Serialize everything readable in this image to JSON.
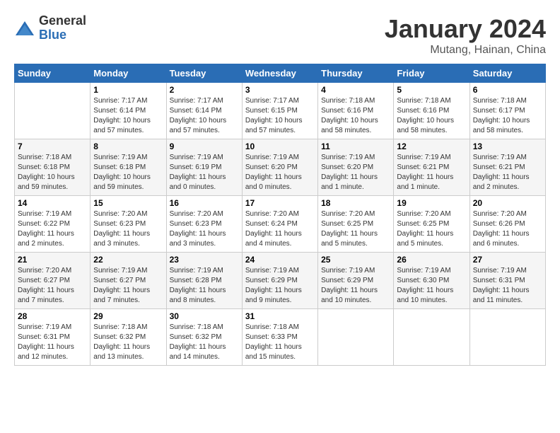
{
  "logo": {
    "general": "General",
    "blue": "Blue"
  },
  "title": "January 2024",
  "subtitle": "Mutang, Hainan, China",
  "days_of_week": [
    "Sunday",
    "Monday",
    "Tuesday",
    "Wednesday",
    "Thursday",
    "Friday",
    "Saturday"
  ],
  "weeks": [
    [
      {
        "day": "",
        "info": ""
      },
      {
        "day": "1",
        "info": "Sunrise: 7:17 AM\nSunset: 6:14 PM\nDaylight: 10 hours\nand 57 minutes."
      },
      {
        "day": "2",
        "info": "Sunrise: 7:17 AM\nSunset: 6:14 PM\nDaylight: 10 hours\nand 57 minutes."
      },
      {
        "day": "3",
        "info": "Sunrise: 7:17 AM\nSunset: 6:15 PM\nDaylight: 10 hours\nand 57 minutes."
      },
      {
        "day": "4",
        "info": "Sunrise: 7:18 AM\nSunset: 6:16 PM\nDaylight: 10 hours\nand 58 minutes."
      },
      {
        "day": "5",
        "info": "Sunrise: 7:18 AM\nSunset: 6:16 PM\nDaylight: 10 hours\nand 58 minutes."
      },
      {
        "day": "6",
        "info": "Sunrise: 7:18 AM\nSunset: 6:17 PM\nDaylight: 10 hours\nand 58 minutes."
      }
    ],
    [
      {
        "day": "7",
        "info": "Sunrise: 7:18 AM\nSunset: 6:18 PM\nDaylight: 10 hours\nand 59 minutes."
      },
      {
        "day": "8",
        "info": "Sunrise: 7:19 AM\nSunset: 6:18 PM\nDaylight: 10 hours\nand 59 minutes."
      },
      {
        "day": "9",
        "info": "Sunrise: 7:19 AM\nSunset: 6:19 PM\nDaylight: 11 hours\nand 0 minutes."
      },
      {
        "day": "10",
        "info": "Sunrise: 7:19 AM\nSunset: 6:20 PM\nDaylight: 11 hours\nand 0 minutes."
      },
      {
        "day": "11",
        "info": "Sunrise: 7:19 AM\nSunset: 6:20 PM\nDaylight: 11 hours\nand 1 minute."
      },
      {
        "day": "12",
        "info": "Sunrise: 7:19 AM\nSunset: 6:21 PM\nDaylight: 11 hours\nand 1 minute."
      },
      {
        "day": "13",
        "info": "Sunrise: 7:19 AM\nSunset: 6:21 PM\nDaylight: 11 hours\nand 2 minutes."
      }
    ],
    [
      {
        "day": "14",
        "info": "Sunrise: 7:19 AM\nSunset: 6:22 PM\nDaylight: 11 hours\nand 2 minutes."
      },
      {
        "day": "15",
        "info": "Sunrise: 7:20 AM\nSunset: 6:23 PM\nDaylight: 11 hours\nand 3 minutes."
      },
      {
        "day": "16",
        "info": "Sunrise: 7:20 AM\nSunset: 6:23 PM\nDaylight: 11 hours\nand 3 minutes."
      },
      {
        "day": "17",
        "info": "Sunrise: 7:20 AM\nSunset: 6:24 PM\nDaylight: 11 hours\nand 4 minutes."
      },
      {
        "day": "18",
        "info": "Sunrise: 7:20 AM\nSunset: 6:25 PM\nDaylight: 11 hours\nand 5 minutes."
      },
      {
        "day": "19",
        "info": "Sunrise: 7:20 AM\nSunset: 6:25 PM\nDaylight: 11 hours\nand 5 minutes."
      },
      {
        "day": "20",
        "info": "Sunrise: 7:20 AM\nSunset: 6:26 PM\nDaylight: 11 hours\nand 6 minutes."
      }
    ],
    [
      {
        "day": "21",
        "info": "Sunrise: 7:20 AM\nSunset: 6:27 PM\nDaylight: 11 hours\nand 7 minutes."
      },
      {
        "day": "22",
        "info": "Sunrise: 7:19 AM\nSunset: 6:27 PM\nDaylight: 11 hours\nand 7 minutes."
      },
      {
        "day": "23",
        "info": "Sunrise: 7:19 AM\nSunset: 6:28 PM\nDaylight: 11 hours\nand 8 minutes."
      },
      {
        "day": "24",
        "info": "Sunrise: 7:19 AM\nSunset: 6:29 PM\nDaylight: 11 hours\nand 9 minutes."
      },
      {
        "day": "25",
        "info": "Sunrise: 7:19 AM\nSunset: 6:29 PM\nDaylight: 11 hours\nand 10 minutes."
      },
      {
        "day": "26",
        "info": "Sunrise: 7:19 AM\nSunset: 6:30 PM\nDaylight: 11 hours\nand 10 minutes."
      },
      {
        "day": "27",
        "info": "Sunrise: 7:19 AM\nSunset: 6:31 PM\nDaylight: 11 hours\nand 11 minutes."
      }
    ],
    [
      {
        "day": "28",
        "info": "Sunrise: 7:19 AM\nSunset: 6:31 PM\nDaylight: 11 hours\nand 12 minutes."
      },
      {
        "day": "29",
        "info": "Sunrise: 7:18 AM\nSunset: 6:32 PM\nDaylight: 11 hours\nand 13 minutes."
      },
      {
        "day": "30",
        "info": "Sunrise: 7:18 AM\nSunset: 6:32 PM\nDaylight: 11 hours\nand 14 minutes."
      },
      {
        "day": "31",
        "info": "Sunrise: 7:18 AM\nSunset: 6:33 PM\nDaylight: 11 hours\nand 15 minutes."
      },
      {
        "day": "",
        "info": ""
      },
      {
        "day": "",
        "info": ""
      },
      {
        "day": "",
        "info": ""
      }
    ]
  ],
  "colors": {
    "header_bg": "#2a6db5",
    "header_text": "#ffffff",
    "border": "#cccccc",
    "text": "#333333"
  }
}
